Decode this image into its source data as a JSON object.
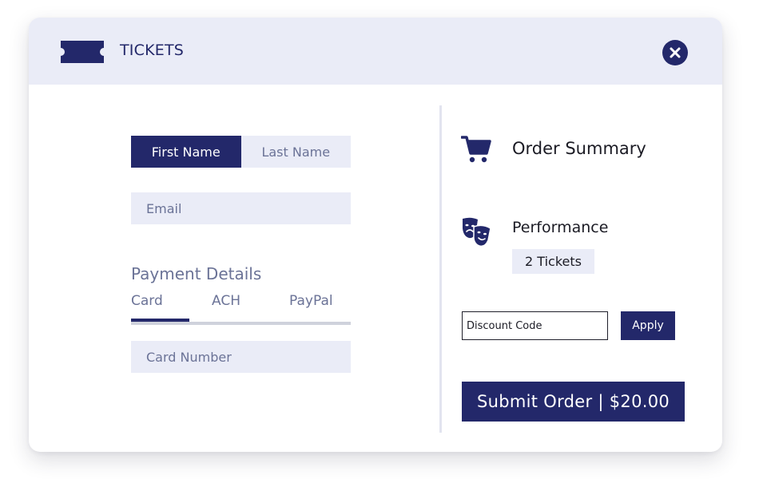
{
  "header": {
    "title": "TICKETS",
    "logo_icon": "ticket-icon",
    "close_icon": "close-icon"
  },
  "form": {
    "first_name_placeholder": "First Name",
    "last_name_placeholder": "Last Name",
    "email_placeholder": "Email",
    "payment_title": "Payment Details",
    "payment_tabs": [
      {
        "label": "Card",
        "active": true
      },
      {
        "label": "ACH",
        "active": false
      },
      {
        "label": "PayPal",
        "active": false
      }
    ],
    "card_number_placeholder": "Card Number"
  },
  "summary": {
    "title": "Order Summary",
    "cart_icon": "cart-icon",
    "performance_icon": "theater-masks-icon",
    "performance_label": "Performance",
    "tickets_badge": "2 Tickets",
    "discount_placeholder": "Discount Code",
    "apply_label": "Apply",
    "submit_label": "Submit Order | $20.00"
  },
  "colors": {
    "primary": "#23286a",
    "light_fill": "#eaecf7",
    "muted_text": "#6b7397"
  }
}
